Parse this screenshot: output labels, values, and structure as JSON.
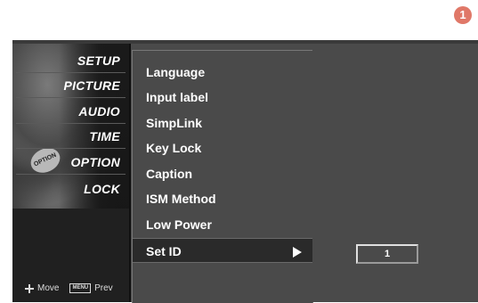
{
  "step_badge": "1",
  "categories": [
    {
      "label": "SETUP"
    },
    {
      "label": "PICTURE"
    },
    {
      "label": "AUDIO"
    },
    {
      "label": "TIME"
    },
    {
      "label": "OPTION"
    },
    {
      "label": "LOCK"
    }
  ],
  "option_icon_text": "OPTION",
  "nav_hint": {
    "move_label": "Move",
    "menu_key": "MENU",
    "prev_label": "Prev"
  },
  "menu_items": [
    {
      "label": "Language"
    },
    {
      "label": "Input label"
    },
    {
      "label": "SimpLink"
    },
    {
      "label": "Key Lock"
    },
    {
      "label": "Caption"
    },
    {
      "label": "ISM Method"
    },
    {
      "label": "Low Power"
    },
    {
      "label": "Set ID"
    }
  ],
  "selected_item": "Set ID",
  "set_id_value": "1"
}
